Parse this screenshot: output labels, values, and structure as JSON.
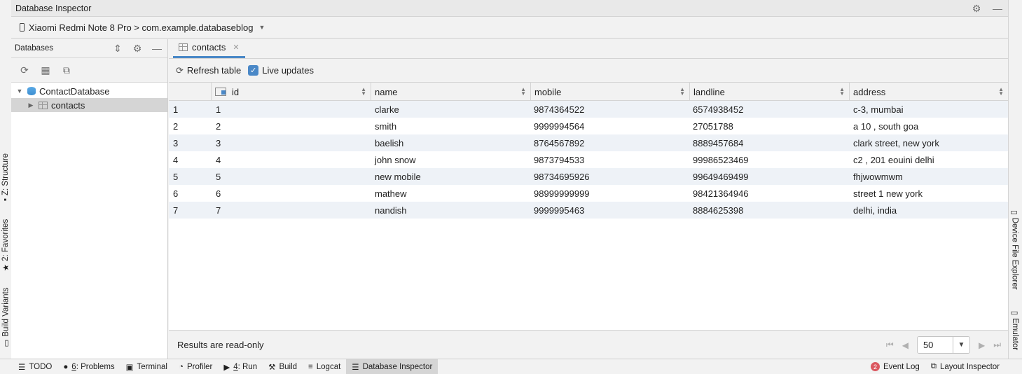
{
  "window": {
    "title": "Database Inspector"
  },
  "device": {
    "label": "Xiaomi Redmi Note 8 Pro > com.example.databaseblog"
  },
  "databases_panel": {
    "title": "Databases",
    "tree": [
      {
        "label": "ContactDatabase",
        "type": "database"
      },
      {
        "label": "contacts",
        "type": "table"
      }
    ]
  },
  "tab": {
    "label": "contacts"
  },
  "toolbar": {
    "refresh_label": "Refresh table",
    "live_updates_label": "Live updates",
    "live_updates_checked": true
  },
  "table": {
    "columns": [
      "id",
      "name",
      "mobile",
      "landline",
      "address"
    ],
    "rows": [
      {
        "n": "1",
        "id": "1",
        "name": "clarke",
        "mobile": "9874364522",
        "landline": "6574938452",
        "address": "c-3, mumbai"
      },
      {
        "n": "2",
        "id": "2",
        "name": "smith",
        "mobile": "9999994564",
        "landline": "27051788",
        "address": "a 10 , south goa"
      },
      {
        "n": "3",
        "id": "3",
        "name": "baelish",
        "mobile": "8764567892",
        "landline": "8889457684",
        "address": "clark street, new york"
      },
      {
        "n": "4",
        "id": "4",
        "name": "john snow",
        "mobile": "9873794533",
        "landline": "99986523469",
        "address": "c2 , 201 eouini delhi"
      },
      {
        "n": "5",
        "id": "5",
        "name": "new mobile",
        "mobile": "98734695926",
        "landline": "99649469499",
        "address": "fhjwowmwm"
      },
      {
        "n": "6",
        "id": "6",
        "name": "mathew",
        "mobile": "98999999999",
        "landline": "98421364946",
        "address": "street 1 new york"
      },
      {
        "n": "7",
        "id": "7",
        "name": "nandish",
        "mobile": "9999995463",
        "landline": "8884625398",
        "address": "delhi, india"
      }
    ]
  },
  "footer": {
    "status": "Results are read-only",
    "page_size": "50"
  },
  "left_tools": {
    "structure": "Z: Structure",
    "favorites": "2: Favorites",
    "build_variants": "Build Variants"
  },
  "right_tools": {
    "device_file_explorer": "Device File Explorer",
    "emulator": "Emulator"
  },
  "bottom_tools": {
    "todo": "TODO",
    "problems_num": "6",
    "problems": ": Problems",
    "terminal": "Terminal",
    "profiler": "Profiler",
    "run_num": "4",
    "run": ": Run",
    "build": "Build",
    "logcat": "Logcat",
    "database_inspector": "Database Inspector",
    "event_log_count": "2",
    "event_log": "Event Log",
    "layout_inspector": "Layout Inspector"
  }
}
